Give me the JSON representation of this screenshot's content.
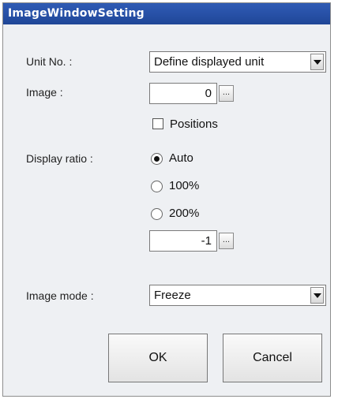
{
  "window": {
    "title": "ImageWindowSetting"
  },
  "unit_no": {
    "label": "Unit No. :",
    "selected": "Define displayed unit"
  },
  "image": {
    "label": "Image :",
    "value": "0",
    "browse_label": "...",
    "positions_label": "Positions",
    "positions_checked": false
  },
  "display_ratio": {
    "label": "Display ratio :",
    "options": [
      {
        "label": "Auto",
        "checked": true
      },
      {
        "label": "100%",
        "checked": false
      },
      {
        "label": "200%",
        "checked": false
      }
    ],
    "custom_value": "-1",
    "browse_label": "..."
  },
  "image_mode": {
    "label": "Image mode :",
    "selected": "Freeze"
  },
  "buttons": {
    "ok": "OK",
    "cancel": "Cancel"
  },
  "colors": {
    "titlebar": "#2750a6",
    "dialog_bg": "#eef0f3"
  }
}
